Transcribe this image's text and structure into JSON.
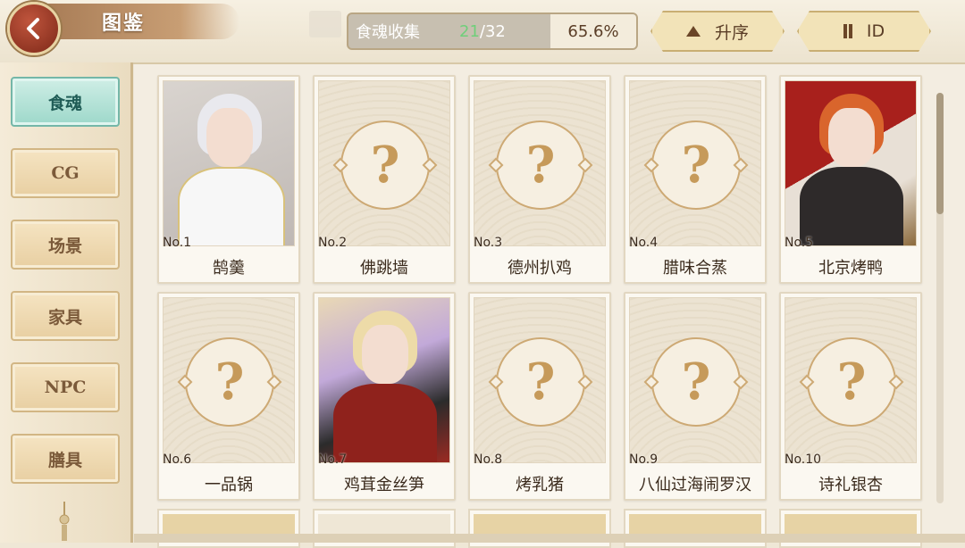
{
  "header": {
    "title": "图鉴",
    "collection": {
      "label": "食魂收集",
      "collected": "21",
      "total": "/32",
      "percent": "65.6%"
    },
    "sort_button": {
      "label": "升序",
      "icon": "triangle-up-icon"
    },
    "id_button": {
      "label": "ID",
      "icon": "sort-order-icon"
    }
  },
  "sidebar": {
    "items": [
      {
        "label": "食魂",
        "active": true
      },
      {
        "label": "CG",
        "active": false
      },
      {
        "label": "场景",
        "active": false
      },
      {
        "label": "家具",
        "active": false
      },
      {
        "label": "NPC",
        "active": false
      },
      {
        "label": "膳具",
        "active": false
      }
    ]
  },
  "cards": [
    {
      "no": "No.1",
      "name": "鹄羹",
      "unlocked": true
    },
    {
      "no": "No.2",
      "name": "佛跳墙",
      "unlocked": false
    },
    {
      "no": "No.3",
      "name": "德州扒鸡",
      "unlocked": false
    },
    {
      "no": "No.4",
      "name": "腊味合蒸",
      "unlocked": false
    },
    {
      "no": "No.5",
      "name": "北京烤鸭",
      "unlocked": true
    },
    {
      "no": "No.6",
      "name": "一品锅",
      "unlocked": false
    },
    {
      "no": "No.7",
      "name": "鸡茸金丝笋",
      "unlocked": true
    },
    {
      "no": "No.8",
      "name": "烤乳猪",
      "unlocked": false
    },
    {
      "no": "No.9",
      "name": "八仙过海闹罗汉",
      "unlocked": false
    },
    {
      "no": "No.10",
      "name": "诗礼银杏",
      "unlocked": false
    }
  ],
  "placeholder_glyph": "?",
  "colors": {
    "active_tab": "#9dd8ca",
    "collected_count": "#6fcf7a",
    "back_button": "#a93a28"
  }
}
